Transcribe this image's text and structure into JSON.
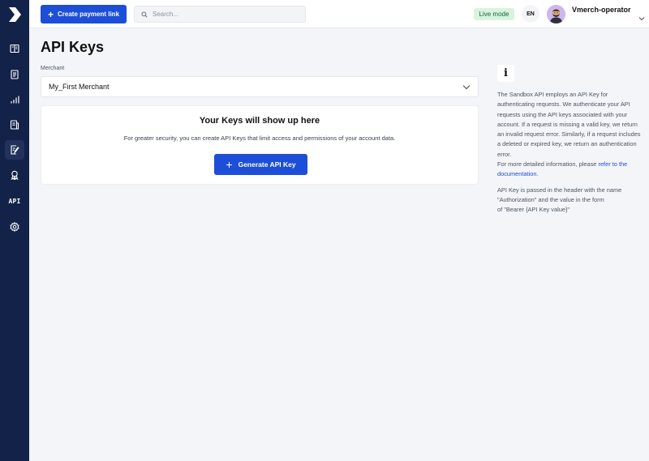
{
  "topbar": {
    "create_payment_link": "Create payment link",
    "search_placeholder": "Search...",
    "live_mode": "Live mode",
    "language": "EN",
    "user_name": "Vmerch-operator"
  },
  "sidebar": {
    "items": [
      {
        "icon": "book-icon"
      },
      {
        "icon": "document-list-icon"
      },
      {
        "icon": "bar-chart-icon"
      },
      {
        "icon": "report-icon"
      },
      {
        "icon": "edit-document-icon",
        "active": true
      },
      {
        "icon": "award-icon"
      },
      {
        "icon": "api-icon",
        "label": "API"
      },
      {
        "icon": "gear-icon"
      }
    ]
  },
  "main": {
    "title": "API Keys",
    "merchant_label": "Merchant",
    "merchant_value": "My_First Merchant",
    "card": {
      "title": "Your Keys will show up here",
      "description": "For greater security, you can create API Keys that limit access and permissions of your account data.",
      "button": "Generate API Key"
    }
  },
  "info": {
    "icon": "i",
    "paragraph1": "The Sandbox API employs an API Key for authenticating requests. We authenticate your API requests using the API keys associated with your account. If a request is missing a valid key, we return an invalid request error. Similarly, if a request includes a deleted or expired key, we return an authentication error.",
    "more_info_prefix": "For more detailed information, please ",
    "more_info_link": "refer to the documentation",
    "more_info_suffix": ".",
    "line1": "API Key is passed in the header with the name",
    "line2": "\"Authorization\" and the value in the form",
    "line3": "of \"Bearer {API Key value}\""
  },
  "colors": {
    "sidebar": "#132249",
    "accent": "#1d4ed8",
    "live_badge_bg": "#d9f3de",
    "page_bg": "#f4f5f8"
  }
}
